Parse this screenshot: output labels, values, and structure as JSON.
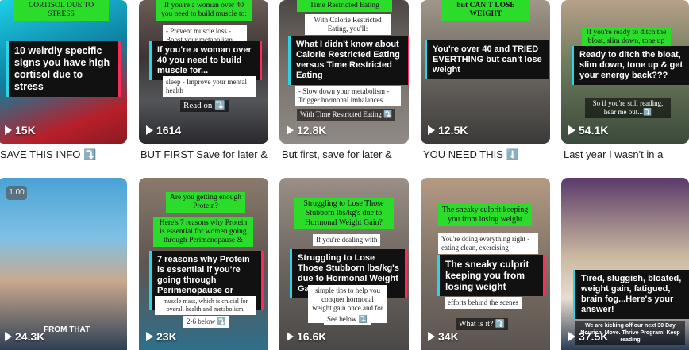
{
  "grid": {
    "row1": [
      {
        "overlay": "10 weirdly specific signs you have high cortisol due to stress",
        "top_tag": "CORTISOL DUE TO STRESS",
        "views": "15K",
        "caption": "SAVE THIS INFO ⤵️"
      },
      {
        "top_note": "If you're a woman over 40 you need to build muscle to:",
        "list_note": "- Prevent muscle loss - Boost your metabolism",
        "overlay": "If you're a woman over 40 you need to build muscle for...",
        "bottom_note": "sleep - Improve your mental health",
        "read_on": "Read on ⤵️",
        "views": "1614",
        "caption": "BUT FIRST Save for later &"
      },
      {
        "top_tag": "Time Restricted Eating",
        "top_note": "With Calorie Restricted Eating, you'll:",
        "overlay": "What I didn't know about Calorie Restricted Eating versus Time Restricted Eating",
        "bottom_note": "- Slow down your metabolism - Trigger hormonal imbalances",
        "footer_note": "With Time Restricted Eating ⤵️",
        "views": "12.8K",
        "caption": "But first, save for later &"
      },
      {
        "top_tag": "but CAN'T LOSE WEIGHT",
        "overlay": "You're over 40 and TRIED EVERTHING but can't lose weight",
        "views": "12.5K",
        "caption": "YOU NEED THIS ⬇️"
      },
      {
        "top_tag": "If you're ready to ditch the bloat, slim down, tone up",
        "overlay": "Ready to ditch the bloat, slim down, tone up & get your energy back???",
        "bottom_note": "So if you're still reading, hear me out...⤵️",
        "views": "54.1K",
        "caption": "Last year I wasn't in a"
      }
    ],
    "row2": [
      {
        "speed_badge": "1.00",
        "subtitle": "FROM THAT",
        "views": "24.3K"
      },
      {
        "top_tag": "Are you getting enough Protein?",
        "second_tag": "Here's 7 reasons why Protein is essential for women going through Perimenopause &",
        "overlay": "7 reasons why Protein is essential if you're going through Perimenopause or Menopause",
        "bottom_note": "muscle mass, which is crucial for overall health and metabolism.",
        "footer_note": "2-6 below ⤵️",
        "views": "23K"
      },
      {
        "top_tag": "Struggling to Lose Those Stubborn lbs/kg's due to Hormonal Weight Gain?",
        "top_note": "If you're dealing with",
        "overlay": "Struggling to Lose Those Stubborn lbs/kg's due to Hormonal Weight Gain?",
        "bottom_note": "simple tips to help you conquer hormonal weight gain once and for all.",
        "footer_note": "See below ⤵️",
        "views": "16.6K"
      },
      {
        "top_tag": "The sneaky culprit keeping you from losing weight",
        "top_note": "You're doing everything right - eating clean, exercising",
        "overlay": "The sneaky culprit keeping you from losing weight",
        "bottom_note": "efforts behind the scenes",
        "footer_note": "What is it? ⤵️",
        "views": "34K"
      },
      {
        "overlay": "Tired, sluggish, bloated, weight gain, fatigued, brain fog...Here's your answer!",
        "bottom_note": "We are kicking off our next 30 Day Nourish. Move. Thrive Program! Keep reading",
        "views": "37.5K"
      }
    ]
  },
  "icons": {
    "views": "play-icon"
  }
}
